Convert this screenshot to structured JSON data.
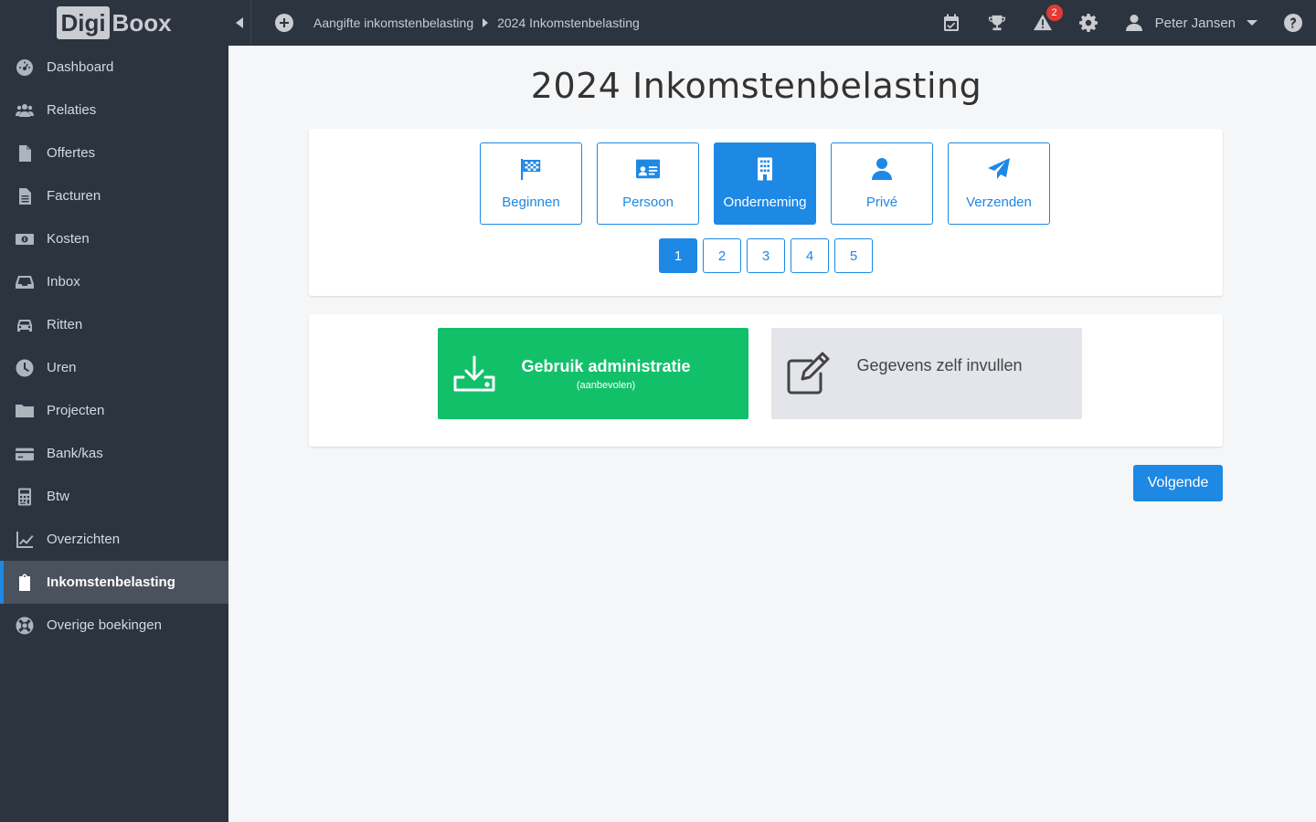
{
  "logo": {
    "part1": "Digi",
    "part2": "Boox"
  },
  "sidebar": {
    "items": [
      {
        "label": "Dashboard",
        "icon": "dashboard-icon"
      },
      {
        "label": "Relaties",
        "icon": "users-icon"
      },
      {
        "label": "Offertes",
        "icon": "file-icon"
      },
      {
        "label": "Facturen",
        "icon": "file-text-icon"
      },
      {
        "label": "Kosten",
        "icon": "money-icon"
      },
      {
        "label": "Inbox",
        "icon": "inbox-icon"
      },
      {
        "label": "Ritten",
        "icon": "car-icon"
      },
      {
        "label": "Uren",
        "icon": "clock-icon"
      },
      {
        "label": "Projecten",
        "icon": "folder-icon"
      },
      {
        "label": "Bank/kas",
        "icon": "credit-card-icon"
      },
      {
        "label": "Btw",
        "icon": "calculator-icon"
      },
      {
        "label": "Overzichten",
        "icon": "chart-line-icon"
      },
      {
        "label": "Inkomstenbelasting",
        "icon": "clipboard-icon",
        "active": true
      },
      {
        "label": "Overige boekingen",
        "icon": "life-ring-icon"
      }
    ]
  },
  "topbar": {
    "breadcrumb": [
      "Aangifte inkomstenbelasting",
      "2024 Inkomstenbelasting"
    ],
    "alert_count": "2",
    "user_name": "Peter Jansen"
  },
  "main": {
    "title": "2024 Inkomstenbelasting",
    "steps": [
      {
        "label": "Beginnen",
        "icon": "flag-checkered-icon"
      },
      {
        "label": "Persoon",
        "icon": "id-card-icon"
      },
      {
        "label": "Onderneming",
        "icon": "building-icon",
        "active": true
      },
      {
        "label": "Privé",
        "icon": "user-icon"
      },
      {
        "label": "Verzenden",
        "icon": "paper-plane-icon"
      }
    ],
    "pages": [
      "1",
      "2",
      "3",
      "4",
      "5"
    ],
    "active_page": "1",
    "option_admin": {
      "title": "Gebruik administratie",
      "subtitle": "(aanbevolen)"
    },
    "option_manual": {
      "title": "Gegevens zelf invullen"
    },
    "next_label": "Volgende"
  },
  "colors": {
    "primary": "#1e88e5",
    "success": "#12c06a",
    "sidebar": "#2c3440",
    "badge": "#e53935"
  }
}
